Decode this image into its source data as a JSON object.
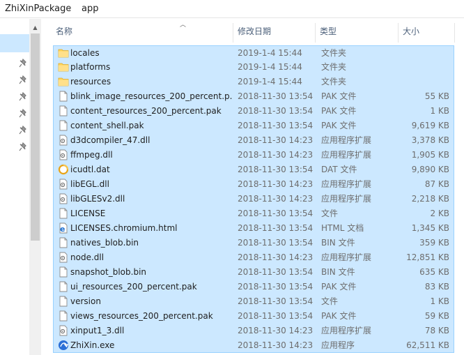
{
  "breadcrumb": {
    "items": [
      "ZhiXinPackage",
      "app"
    ],
    "separator": "›"
  },
  "columns": {
    "name": "名称",
    "modified": "修改日期",
    "type": "类型",
    "size": "大小"
  },
  "files": [
    {
      "name": "locales",
      "modified": "2019-1-4 15:44",
      "type": "文件夹",
      "size": "",
      "icon": "folder-icon"
    },
    {
      "name": "platforms",
      "modified": "2019-1-4 15:44",
      "type": "文件夹",
      "size": "",
      "icon": "folder-icon"
    },
    {
      "name": "resources",
      "modified": "2019-1-4 15:44",
      "type": "文件夹",
      "size": "",
      "icon": "folder-icon"
    },
    {
      "name": "blink_image_resources_200_percent.p...",
      "modified": "2018-11-30 13:54",
      "type": "PAK 文件",
      "size": "55 KB",
      "icon": "file-icon"
    },
    {
      "name": "content_resources_200_percent.pak",
      "modified": "2018-11-30 13:54",
      "type": "PAK 文件",
      "size": "1 KB",
      "icon": "file-icon"
    },
    {
      "name": "content_shell.pak",
      "modified": "2018-11-30 13:54",
      "type": "PAK 文件",
      "size": "9,619 KB",
      "icon": "file-icon"
    },
    {
      "name": "d3dcompiler_47.dll",
      "modified": "2018-11-30 14:23",
      "type": "应用程序扩展",
      "size": "3,378 KB",
      "icon": "dll-icon"
    },
    {
      "name": "ffmpeg.dll",
      "modified": "2018-11-30 14:23",
      "type": "应用程序扩展",
      "size": "1,905 KB",
      "icon": "dll-icon"
    },
    {
      "name": "icudtl.dat",
      "modified": "2018-11-30 13:54",
      "type": "DAT 文件",
      "size": "9,890 KB",
      "icon": "dat-icon"
    },
    {
      "name": "libEGL.dll",
      "modified": "2018-11-30 14:23",
      "type": "应用程序扩展",
      "size": "87 KB",
      "icon": "dll-icon"
    },
    {
      "name": "libGLESv2.dll",
      "modified": "2018-11-30 14:23",
      "type": "应用程序扩展",
      "size": "2,218 KB",
      "icon": "dll-icon"
    },
    {
      "name": "LICENSE",
      "modified": "2018-11-30 13:54",
      "type": "文件",
      "size": "2 KB",
      "icon": "file-icon"
    },
    {
      "name": "LICENSES.chromium.html",
      "modified": "2018-11-30 13:54",
      "type": "HTML 文档",
      "size": "1,345 KB",
      "icon": "html-icon"
    },
    {
      "name": "natives_blob.bin",
      "modified": "2018-11-30 13:54",
      "type": "BIN 文件",
      "size": "359 KB",
      "icon": "file-icon"
    },
    {
      "name": "node.dll",
      "modified": "2018-11-30 14:23",
      "type": "应用程序扩展",
      "size": "12,851 KB",
      "icon": "dll-icon"
    },
    {
      "name": "snapshot_blob.bin",
      "modified": "2018-11-30 13:54",
      "type": "BIN 文件",
      "size": "635 KB",
      "icon": "file-icon"
    },
    {
      "name": "ui_resources_200_percent.pak",
      "modified": "2018-11-30 13:54",
      "type": "PAK 文件",
      "size": "83 KB",
      "icon": "file-icon"
    },
    {
      "name": "version",
      "modified": "2018-11-30 13:54",
      "type": "文件",
      "size": "1 KB",
      "icon": "file-icon"
    },
    {
      "name": "views_resources_200_percent.pak",
      "modified": "2018-11-30 13:54",
      "type": "PAK 文件",
      "size": "59 KB",
      "icon": "file-icon"
    },
    {
      "name": "xinput1_3.dll",
      "modified": "2018-11-30 14:23",
      "type": "应用程序扩展",
      "size": "78 KB",
      "icon": "dll-icon"
    },
    {
      "name": "ZhiXin.exe",
      "modified": "2018-11-30 14:23",
      "type": "应用程序",
      "size": "62,511 KB",
      "icon": "app-icon"
    }
  ],
  "colors": {
    "selection": "#cce8ff",
    "selection_border": "#99d1ff",
    "folder": "#ffd45a",
    "header_text": "#4c607a"
  }
}
